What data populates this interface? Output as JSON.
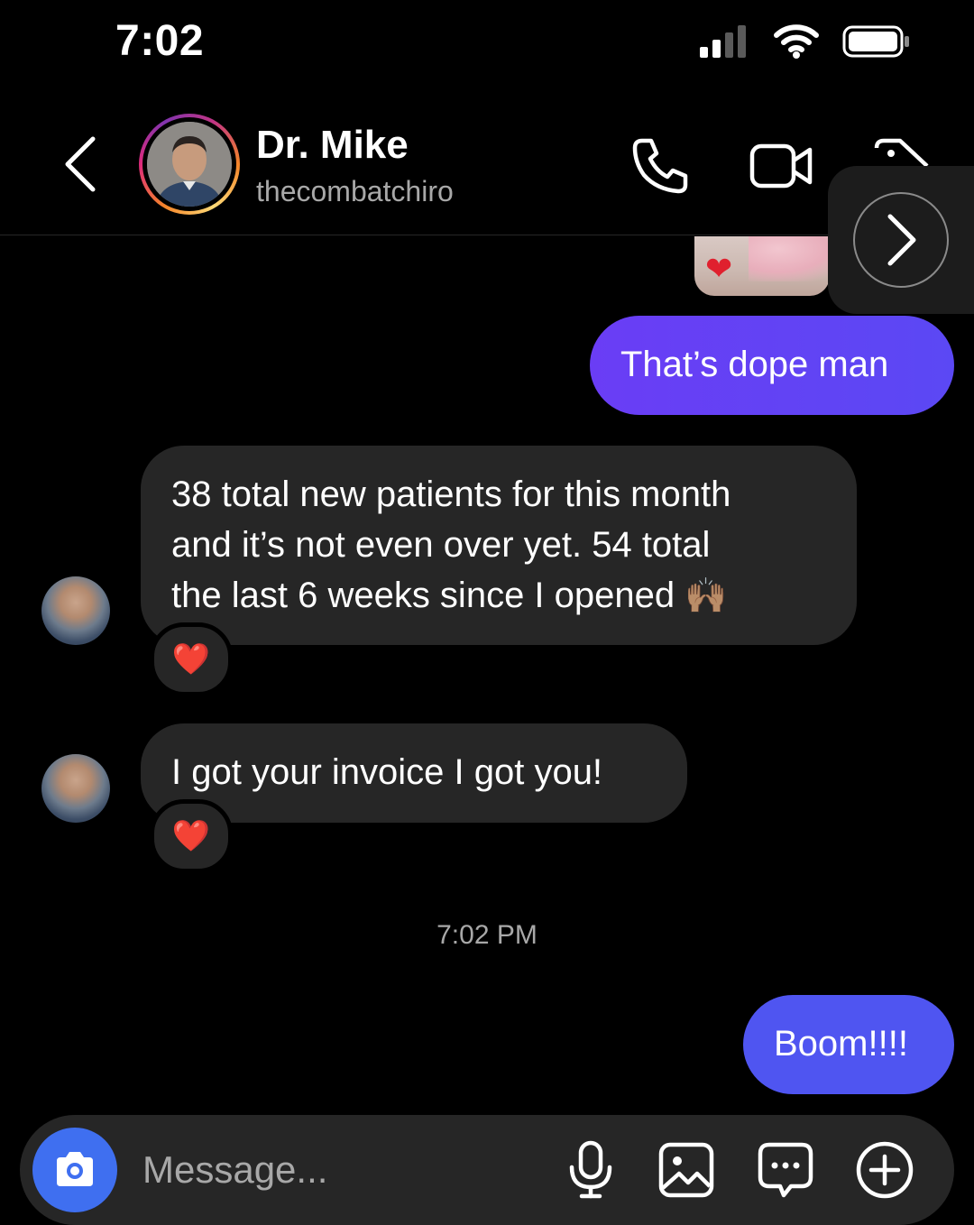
{
  "status_bar": {
    "time": "7:02"
  },
  "header": {
    "name": "Dr. Mike",
    "username": "thecombatchiro",
    "icons": {
      "back": "chevron-left-icon",
      "call": "phone-icon",
      "video": "video-camera-icon",
      "tag": "tag-icon",
      "next": "chevron-right-icon"
    }
  },
  "messages": [
    {
      "direction": "outgoing",
      "text": "That’s dope man"
    },
    {
      "direction": "incoming",
      "lines": [
        "38 total new patients for this month",
        "and it’s not even over yet. 54 total",
        "the last 6 weeks since I opened"
      ],
      "trailing_emoji": "🙌🏽",
      "reaction": "❤️"
    },
    {
      "direction": "incoming",
      "text": "I got your invoice I got you!",
      "reaction": "❤️"
    },
    {
      "direction": "outgoing",
      "text": "Boom!!!!"
    }
  ],
  "photo_reaction": "❤",
  "timestamp": "7:02 PM",
  "composer": {
    "placeholder": "Message...",
    "icons": [
      "camera-icon",
      "microphone-icon",
      "gallery-icon",
      "sticker-chat-icon",
      "plus-circle-icon"
    ]
  },
  "colors": {
    "outgoing_bubble": "#6a3df5",
    "incoming_bubble": "#262626",
    "camera_button": "#3f6ff0",
    "background": "#000000"
  }
}
